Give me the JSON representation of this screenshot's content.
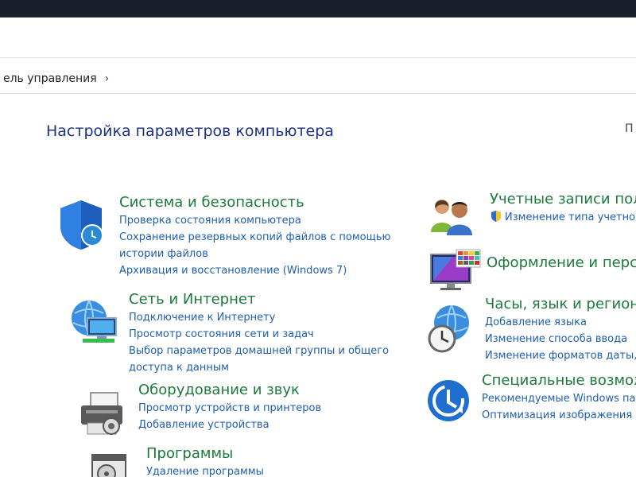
{
  "address": {
    "breadcrumb": "ель управления",
    "chevron": "›"
  },
  "page": {
    "title": "Настройка параметров компьютера",
    "view_by": "П"
  },
  "left": [
    {
      "id": "system",
      "title": "Система и безопасность",
      "links": [
        "Проверка состояния компьютера",
        "Сохранение резервных копий файлов с помощью истории файлов",
        "Архивация и восстановление (Windows 7)"
      ]
    },
    {
      "id": "network",
      "title": "Сеть и Интернет",
      "links": [
        "Подключение к Интернету",
        "Просмотр состояния сети и задач",
        "Выбор параметров домашней группы и общего доступа к данным"
      ]
    },
    {
      "id": "hardware",
      "title": "Оборудование и звук",
      "links": [
        "Просмотр устройств и принтеров",
        "Добавление устройства"
      ]
    },
    {
      "id": "programs",
      "title": "Программы",
      "links": [
        "Удаление программы"
      ]
    }
  ],
  "right": [
    {
      "id": "accounts",
      "title": "Учетные записи поль",
      "links": [
        "Изменение типа учетно"
      ]
    },
    {
      "id": "appearance",
      "title": "Оформление и персо",
      "links": []
    },
    {
      "id": "clock",
      "title": "Часы, язык и регион",
      "links": [
        "Добавление языка",
        "Изменение способа ввода",
        "Изменение форматов даты, в"
      ]
    },
    {
      "id": "ease",
      "title": "Специальные возмож",
      "links": [
        "Рекомендуемые Windows пар",
        "Оптимизация изображения на"
      ]
    }
  ]
}
